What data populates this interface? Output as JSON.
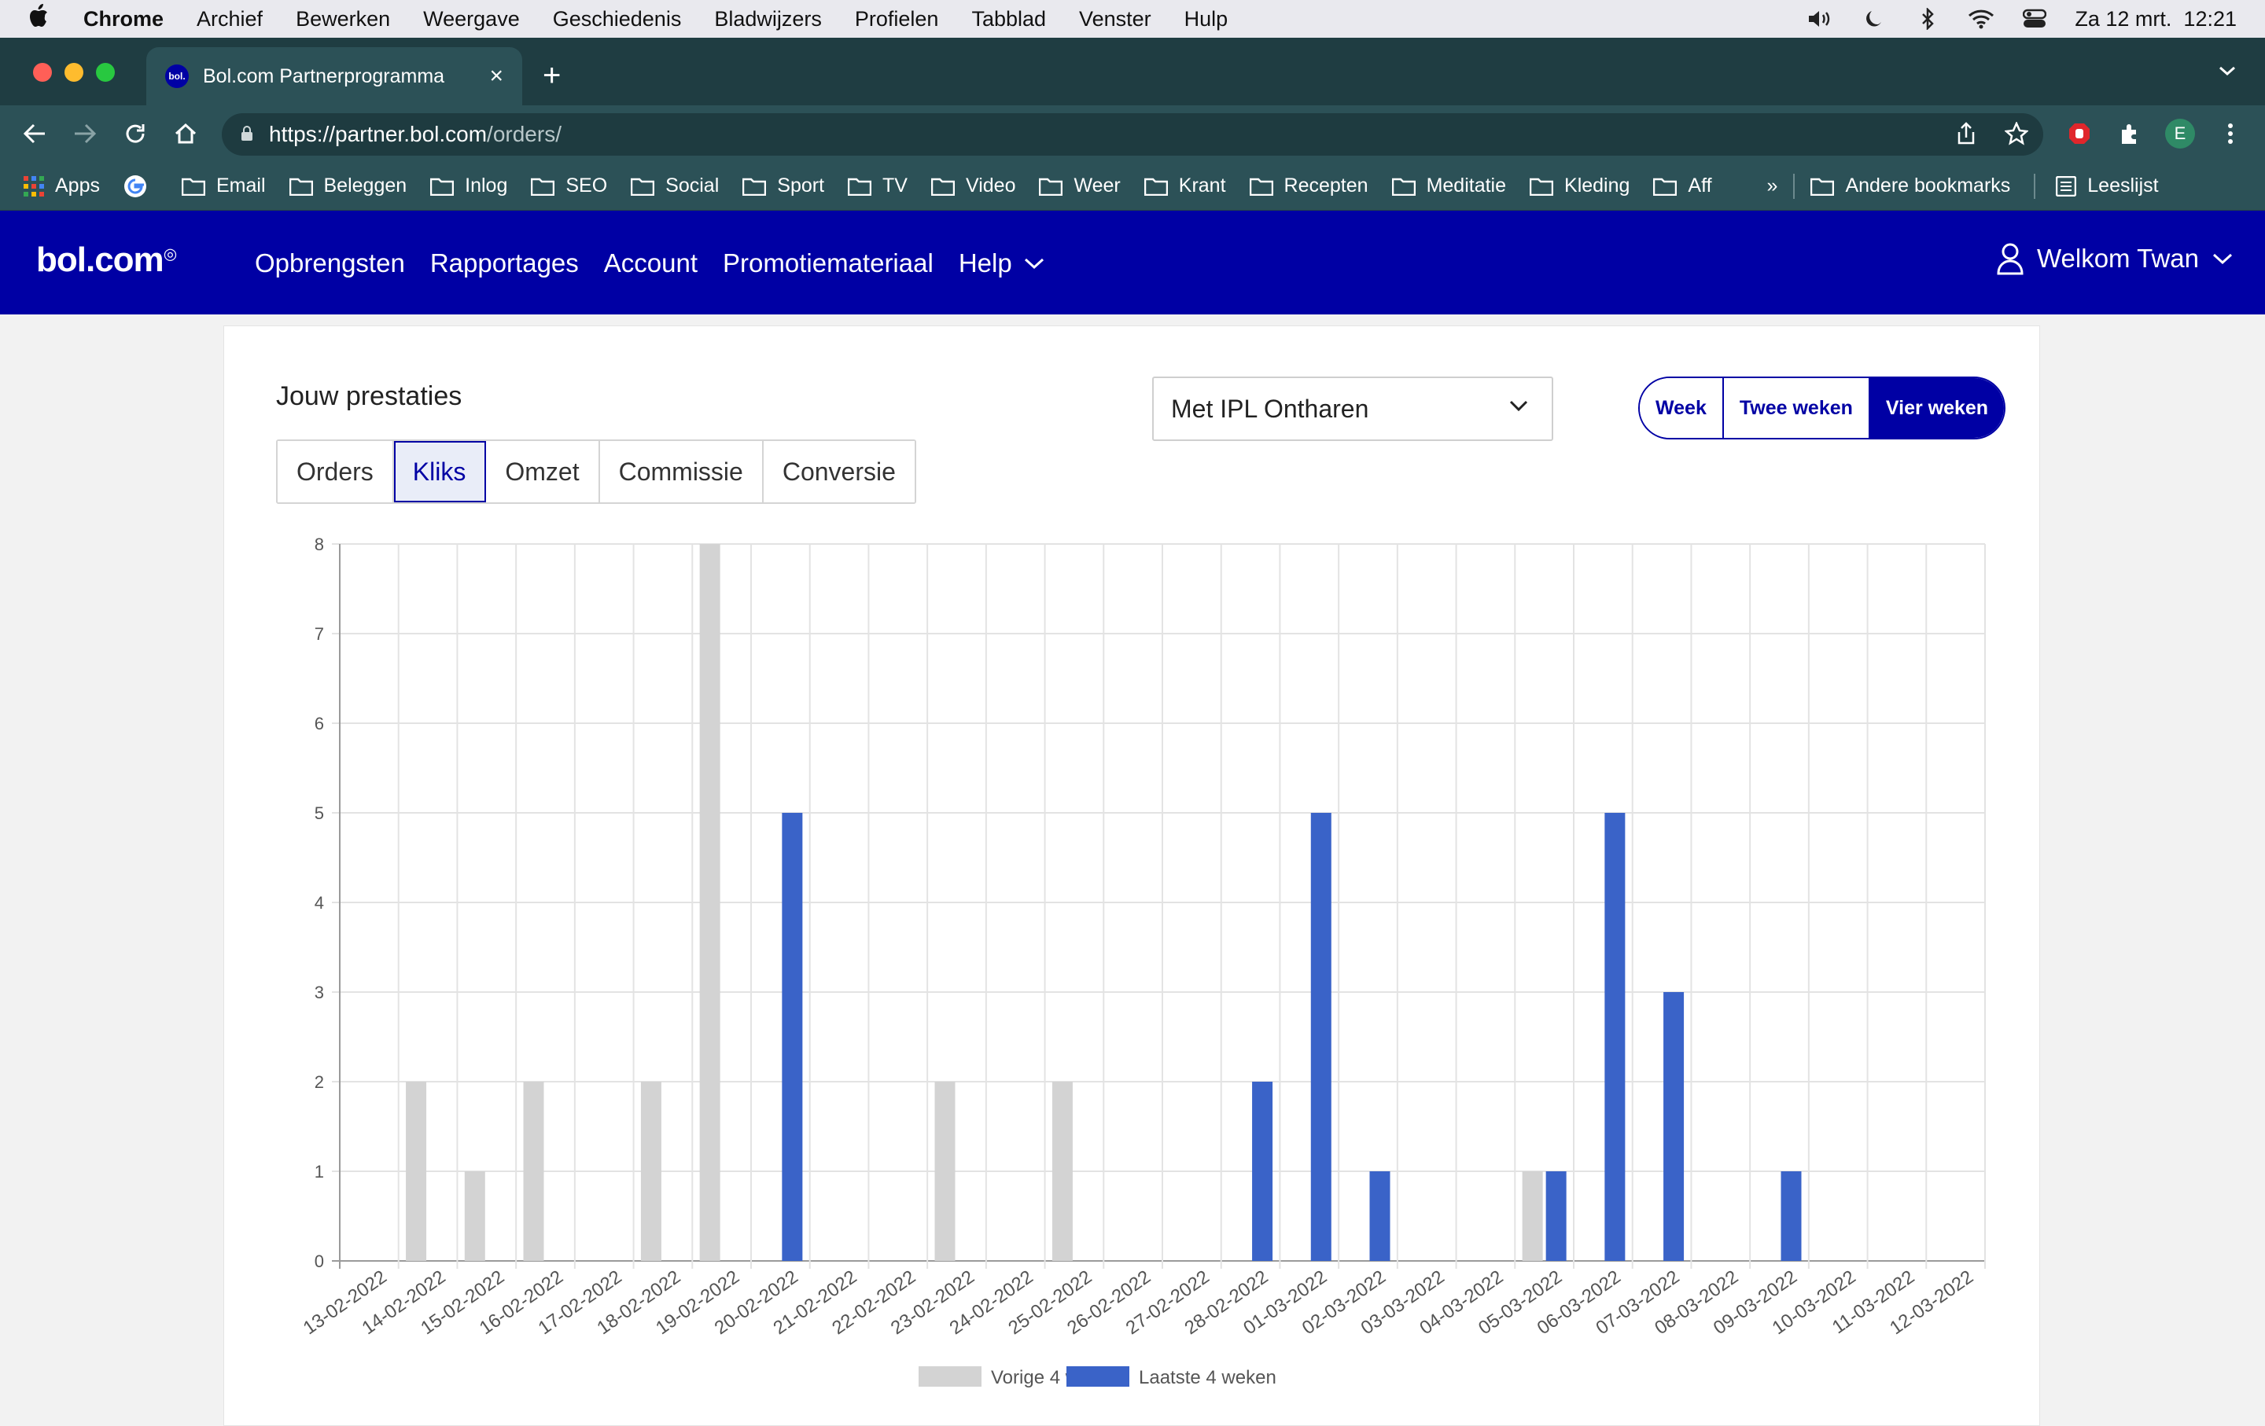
{
  "menubar": {
    "app": "Chrome",
    "items": [
      "Archief",
      "Bewerken",
      "Weergave",
      "Geschiedenis",
      "Bladwijzers",
      "Profielen",
      "Tabblad",
      "Venster",
      "Hulp"
    ],
    "datetime": "Za 12 mrt.  12:21"
  },
  "browser": {
    "tab_title": "Bol.com Partnerprogramma",
    "favicon": "bol.",
    "url_host": "https://partner.bol.com",
    "url_path": "/orders/",
    "profile_initial": "E"
  },
  "bookmarks": {
    "items": [
      "Apps",
      "Email",
      "Beleggen",
      "Inlog",
      "SEO",
      "Social",
      "Sport",
      "TV",
      "Video",
      "Weer",
      "Krant",
      "Recepten",
      "Meditatie",
      "Kleding",
      "Aff"
    ],
    "more": "»",
    "other": "Andere bookmarks",
    "reading_list": "Leeslijst"
  },
  "site": {
    "logo": "bol.com",
    "nav": [
      "Opbrengsten",
      "Rapportages",
      "Account",
      "Promotiemateriaal",
      "Help"
    ],
    "welcome": "Welkom Twan"
  },
  "performance": {
    "title": "Jouw prestaties",
    "metrics": [
      "Orders",
      "Kliks",
      "Omzet",
      "Commissie",
      "Conversie"
    ],
    "active_metric": "Kliks",
    "filter_value": "Met IPL Ontharen",
    "periods": [
      "Week",
      "Twee weken",
      "Vier weken"
    ],
    "active_period": "Vier weken"
  },
  "colors": {
    "brand": "#0000a4",
    "previous": "#d3d3d3",
    "current": "#3a63c8"
  },
  "chart_data": {
    "type": "bar",
    "categories": [
      "13-02-2022",
      "14-02-2022",
      "15-02-2022",
      "16-02-2022",
      "17-02-2022",
      "18-02-2022",
      "19-02-2022",
      "20-02-2022",
      "21-02-2022",
      "22-02-2022",
      "23-02-2022",
      "24-02-2022",
      "25-02-2022",
      "26-02-2022",
      "27-02-2022",
      "28-02-2022",
      "01-03-2022",
      "02-03-2022",
      "03-03-2022",
      "04-03-2022",
      "05-03-2022",
      "06-03-2022",
      "07-03-2022",
      "08-03-2022",
      "09-03-2022",
      "10-03-2022",
      "11-03-2022",
      "12-03-2022"
    ],
    "series": [
      {
        "name": "Vorige 4 weken",
        "values": [
          0,
          2,
          1,
          2,
          0,
          2,
          8,
          0,
          0,
          0,
          2,
          0,
          2,
          0,
          0,
          0,
          0,
          0,
          0,
          0,
          1,
          0,
          0,
          0,
          0,
          0,
          0,
          0
        ]
      },
      {
        "name": "Laatste 4 weken",
        "values": [
          0,
          0,
          0,
          0,
          0,
          0,
          0,
          5,
          0,
          0,
          0,
          0,
          0,
          0,
          0,
          2,
          5,
          1,
          0,
          0,
          1,
          5,
          3,
          0,
          1,
          0,
          0,
          0
        ]
      }
    ],
    "yticks": [
      0,
      1,
      2,
      3,
      4,
      5,
      6,
      7,
      8
    ],
    "ylim": [
      0,
      8
    ],
    "grid": true,
    "legend": "bottom"
  }
}
